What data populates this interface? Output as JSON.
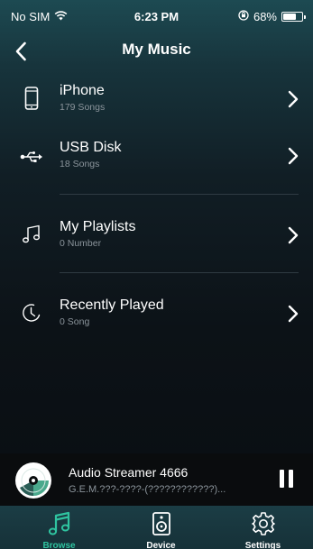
{
  "status_bar": {
    "carrier": "No SIM",
    "time": "6:23 PM",
    "battery_percent_label": "68%",
    "battery_level": 0.68
  },
  "nav": {
    "title": "My Music"
  },
  "list": {
    "items": [
      {
        "title": "iPhone",
        "subtitle": "179 Songs",
        "icon": "phone-icon"
      },
      {
        "title": "USB Disk",
        "subtitle": "18 Songs",
        "icon": "usb-icon"
      },
      {
        "title": "My Playlists",
        "subtitle": "0 Number",
        "icon": "music-note-icon"
      },
      {
        "title": "Recently Played",
        "subtitle": "0 Song",
        "icon": "clock-icon"
      }
    ]
  },
  "player": {
    "title": "Audio Streamer 4666",
    "subtitle": "G.E.M.???-????-(????????????)..."
  },
  "tabs": [
    {
      "label": "Browse",
      "icon": "music-note-icon",
      "active": true
    },
    {
      "label": "Device",
      "icon": "speaker-icon",
      "active": false
    },
    {
      "label": "Settings",
      "icon": "gear-icon",
      "active": false
    }
  ],
  "colors": {
    "accent": "#2fc4a0",
    "tab_inactive": "#ffffff",
    "subtitle": "#8b949b"
  }
}
